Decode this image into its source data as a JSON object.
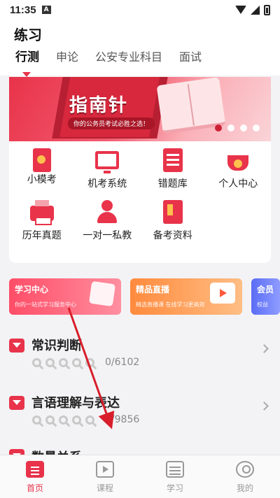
{
  "status_bar": {
    "time": "11:35",
    "notification_icon": "A"
  },
  "header": {
    "title": "练习",
    "tabs": [
      "行测",
      "申论",
      "公安专业科目",
      "面试"
    ],
    "active_tab": 0
  },
  "banner": {
    "title": "指南针",
    "subtitle": "你的公务员考试必胜之选！",
    "slides": 4,
    "active_slide": 0
  },
  "grid": [
    {
      "label": "小模考",
      "icon": "certificate-icon"
    },
    {
      "label": "机考系统",
      "icon": "monitor-icon"
    },
    {
      "label": "错题库",
      "icon": "clipboard-list-icon"
    },
    {
      "label": "个人中心",
      "icon": "crown-icon"
    },
    {
      "label": "历年真题",
      "icon": "printer-icon"
    },
    {
      "label": "一对一私教",
      "icon": "person-icon"
    },
    {
      "label": "备考资料",
      "icon": "book-icon"
    }
  ],
  "promos": [
    {
      "title": "学习中心",
      "subtitle": "你的一站式学习服务中心",
      "color": "#ff4d67"
    },
    {
      "title": "精品直播",
      "subtitle": "精选直播课 在线学习更高效",
      "color": "#ff8a3d"
    },
    {
      "title": "会员",
      "subtitle": "权益",
      "color": "#5a6cf5"
    }
  ],
  "sections": [
    {
      "title": "常识判断",
      "progress": "0/6102"
    },
    {
      "title": "言语理解与表达",
      "progress": "0/9856"
    },
    {
      "title": "数量关系",
      "progress": ""
    }
  ],
  "bottom_nav": [
    {
      "label": "首页",
      "icon": "home-icon",
      "active": true
    },
    {
      "label": "课程",
      "icon": "course-icon",
      "active": false
    },
    {
      "label": "学习",
      "icon": "study-icon",
      "active": false
    },
    {
      "label": "我的",
      "icon": "profile-icon",
      "active": false
    }
  ],
  "colors": {
    "accent": "#e8334a",
    "annotation_arrow": "#d81e2a"
  }
}
